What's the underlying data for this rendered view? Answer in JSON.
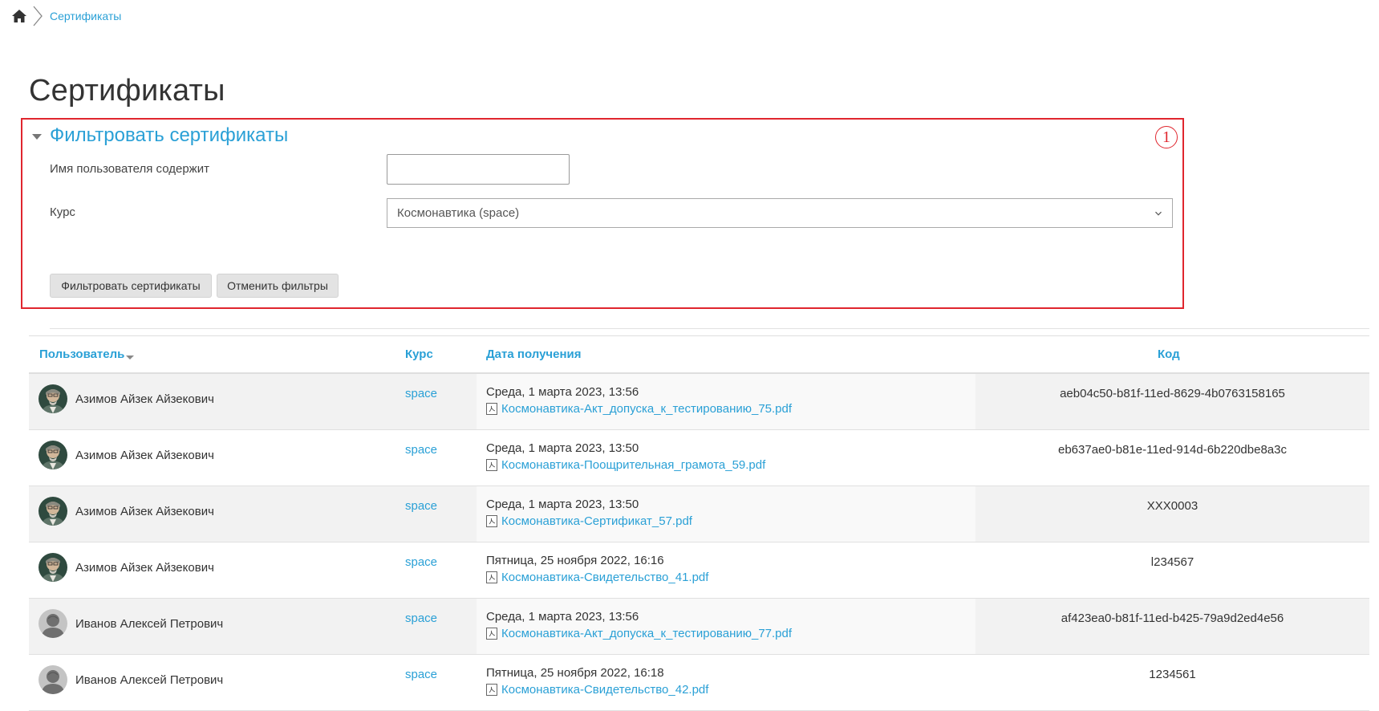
{
  "breadcrumb": {
    "home_icon": "home-icon",
    "current": "Сертификаты"
  },
  "page": {
    "title": "Сертификаты"
  },
  "filter": {
    "title": "Фильтровать сертификаты",
    "annotation": "1",
    "username_label": "Имя пользователя содержит",
    "username_value": "",
    "course_label": "Курс",
    "course_selected": "Космонавтика (space)",
    "apply_button": "Фильтровать сертификаты",
    "reset_button": "Отменить фильтры",
    "border_color": "#e0262e"
  },
  "table": {
    "headers": {
      "user": "Пользователь",
      "course": "Курс",
      "date": "Дата получения",
      "code": "Код"
    },
    "rows": [
      {
        "user": "Азимов Айзек Айзекович",
        "avatar": "photo",
        "course": "space",
        "date": "Среда, 1 марта 2023, 13:56",
        "file": "Космонавтика-Акт_допуска_к_тестированию_75.pdf",
        "code": "aeb04c50-b81f-11ed-8629-4b0763158165"
      },
      {
        "user": "Азимов Айзек Айзекович",
        "avatar": "photo",
        "course": "space",
        "date": "Среда, 1 марта 2023, 13:50",
        "file": "Космонавтика-Поощрительная_грамота_59.pdf",
        "code": "eb637ae0-b81e-11ed-914d-6b220dbe8a3c"
      },
      {
        "user": "Азимов Айзек Айзекович",
        "avatar": "photo",
        "course": "space",
        "date": "Среда, 1 марта 2023, 13:50",
        "file": "Космонавтика-Сертификат_57.pdf",
        "code": "XXX0003"
      },
      {
        "user": "Азимов Айзек Айзекович",
        "avatar": "photo",
        "course": "space",
        "date": "Пятница, 25 ноября 2022, 16:16",
        "file": "Космонавтика-Свидетельство_41.pdf",
        "code": "l234567"
      },
      {
        "user": "Иванов Алексей Петрович",
        "avatar": "default",
        "course": "space",
        "date": "Среда, 1 марта 2023, 13:56",
        "file": "Космонавтика-Акт_допуска_к_тестированию_77.pdf",
        "code": "af423ea0-b81f-11ed-b425-79a9d2ed4e56"
      },
      {
        "user": "Иванов Алексей Петрович",
        "avatar": "default",
        "course": "space",
        "date": "Пятница, 25 ноября 2022, 16:18",
        "file": "Космонавтика-Свидетельство_42.pdf",
        "code": "1234561"
      }
    ]
  },
  "colors": {
    "link": "#2aa0d6",
    "annotation": "#e0262e",
    "stripe": "#f2f2f2"
  }
}
